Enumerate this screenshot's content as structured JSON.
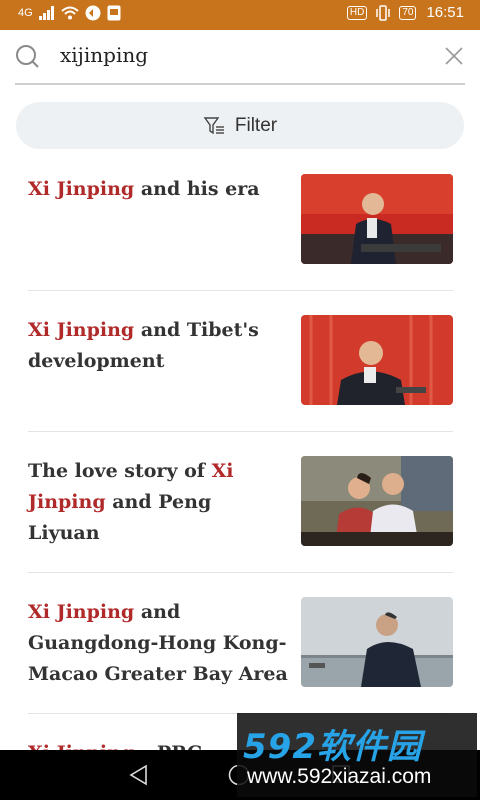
{
  "status_bar": {
    "network": "4G",
    "hd": "HD",
    "battery": "70",
    "time": "16:51",
    "color": "#c8741d"
  },
  "search": {
    "query": "xijinping"
  },
  "filter": {
    "label": "Filter"
  },
  "results": [
    {
      "parts": [
        {
          "text": "Xi Jinping",
          "hl": true
        },
        {
          "text": " and his era",
          "hl": false
        }
      ],
      "thumb_icon": "podium-photo"
    },
    {
      "parts": [
        {
          "text": "Xi Jinping",
          "hl": true
        },
        {
          "text": " and Tibet's development",
          "hl": false
        }
      ],
      "thumb_icon": "speech-photo"
    },
    {
      "parts": [
        {
          "text": "The love story of ",
          "hl": false
        },
        {
          "text": "Xi Jinping",
          "hl": true
        },
        {
          "text": " and Peng Liyuan",
          "hl": false
        }
      ],
      "thumb_icon": "couple-photo"
    },
    {
      "parts": [
        {
          "text": "Xi Jinping",
          "hl": true
        },
        {
          "text": " and Guangdong-Hong Kong-Macao Greater Bay Area",
          "hl": false
        }
      ],
      "thumb_icon": "river-photo"
    },
    {
      "parts": [
        {
          "text": "Xi Jinping",
          "hl": true
        },
        {
          "text": " – PRC",
          "hl": false
        }
      ],
      "thumb_icon": ""
    }
  ],
  "highlight_color": "#b02a2a",
  "watermark": {
    "top": "592软件园",
    "bottom": "www.592xiazai.com"
  }
}
